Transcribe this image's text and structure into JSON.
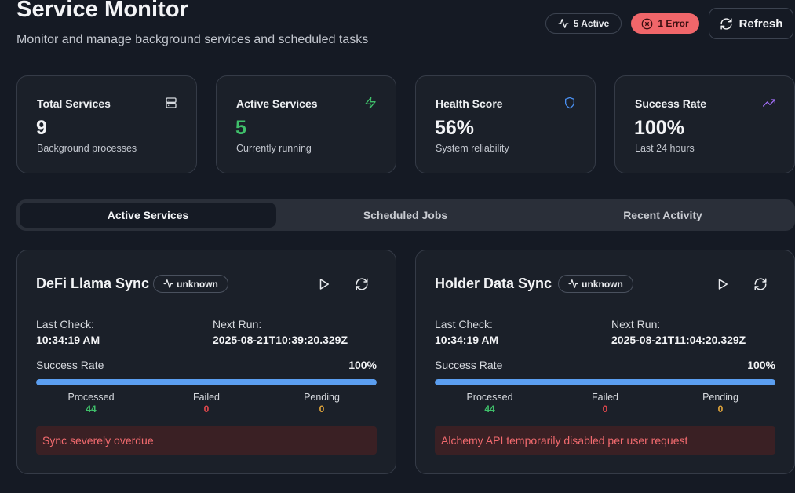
{
  "header": {
    "title": "Service Monitor",
    "subtitle": "Monitor and manage background services and scheduled tasks",
    "active_badge": "5 Active",
    "error_badge": "1 Error",
    "refresh_label": "Refresh"
  },
  "stats": [
    {
      "label": "Total Services",
      "value": "9",
      "sub": "Background processes",
      "icon": "server-icon",
      "color": "#f3f4f6"
    },
    {
      "label": "Active Services",
      "value": "5",
      "sub": "Currently running",
      "icon": "zap-icon",
      "color": "#3fbf6a"
    },
    {
      "label": "Health Score",
      "value": "56%",
      "sub": "System reliability",
      "icon": "shield-icon",
      "color": "#f3f4f6"
    },
    {
      "label": "Success Rate",
      "value": "100%",
      "sub": "Last 24 hours",
      "icon": "trending-up-icon",
      "color": "#f3f4f6"
    }
  ],
  "tabs": [
    {
      "label": "Active Services",
      "active": true
    },
    {
      "label": "Scheduled Jobs",
      "active": false
    },
    {
      "label": "Recent Activity",
      "active": false
    }
  ],
  "services": [
    {
      "name": "DeFi Llama Sync",
      "status": "unknown",
      "last_check_label": "Last Check:",
      "last_check": "10:34:19 AM",
      "next_run_label": "Next Run:",
      "next_run": "2025-08-21T10:39:20.329Z",
      "success_rate_label": "Success Rate",
      "success_rate": "100%",
      "success_fraction": 1.0,
      "processed_label": "Processed",
      "processed": "44",
      "failed_label": "Failed",
      "failed": "0",
      "pending_label": "Pending",
      "pending": "0",
      "error": "Sync severely overdue"
    },
    {
      "name": "Holder Data Sync",
      "status": "unknown",
      "last_check_label": "Last Check:",
      "last_check": "10:34:19 AM",
      "next_run_label": "Next Run:",
      "next_run": "2025-08-21T11:04:20.329Z",
      "success_rate_label": "Success Rate",
      "success_rate": "100%",
      "success_fraction": 1.0,
      "processed_label": "Processed",
      "processed": "44",
      "failed_label": "Failed",
      "failed": "0",
      "pending_label": "Pending",
      "pending": "0",
      "error": "Alchemy API temporarily disabled per user request"
    }
  ],
  "colors": {
    "processed": "#3fbf6a",
    "failed": "#e5484d",
    "pending": "#e2a63b",
    "progress": "#5b9ef0"
  }
}
